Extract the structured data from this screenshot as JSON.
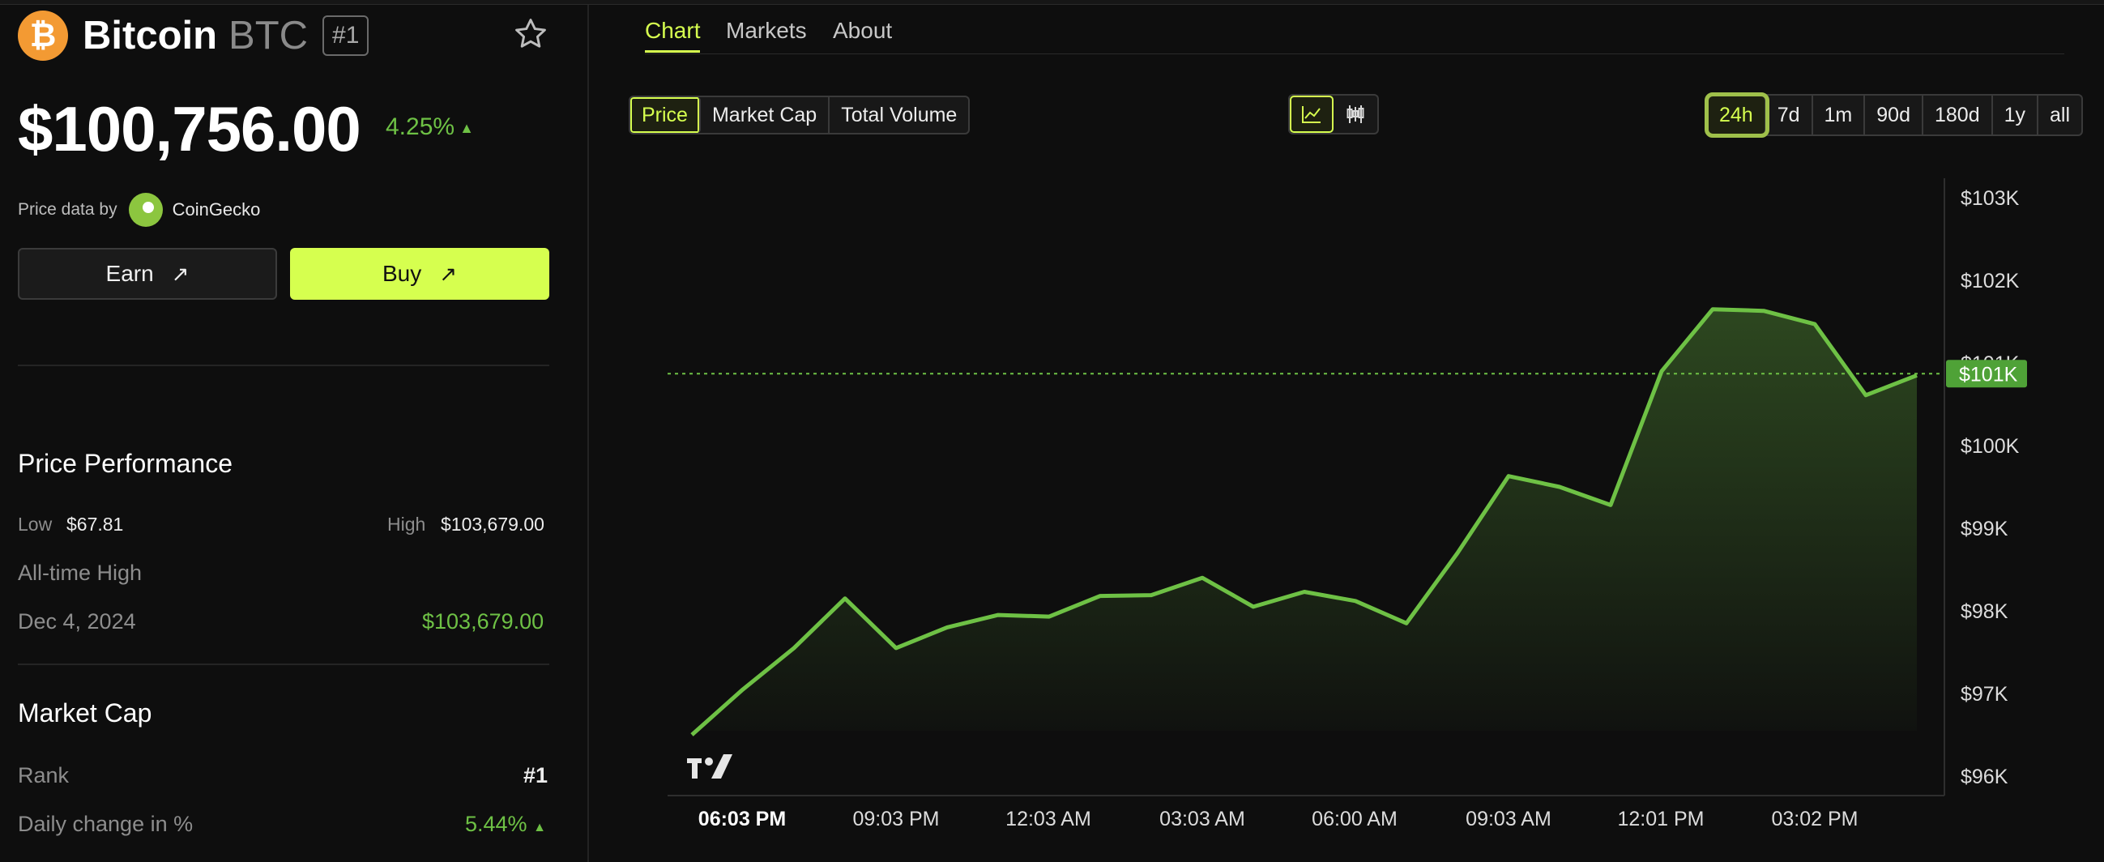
{
  "coin": {
    "name": "Bitcoin",
    "symbol": "BTC",
    "rank_badge": "#1",
    "logo_glyph": "₿",
    "price": "$100,756.00",
    "change": "4.25%",
    "change_arrow": "▲"
  },
  "price_data": {
    "label": "Price data by",
    "provider": "CoinGecko"
  },
  "buttons": {
    "earn": "Earn",
    "buy": "Buy",
    "arrow": "↗"
  },
  "performance": {
    "title": "Price Performance",
    "low_label": "Low",
    "low_value": "$67.81",
    "high_label": "High",
    "high_value": "$103,679.00",
    "ath_label": "All-time High",
    "ath_date": "Dec 4, 2024",
    "ath_value": "$103,679.00"
  },
  "market_cap": {
    "title": "Market Cap",
    "rank_label": "Rank",
    "rank_value": "#1",
    "daily_label": "Daily change in %",
    "daily_value": "5.44%",
    "daily_arrow": "▲"
  },
  "tabs": [
    "Chart",
    "Markets",
    "About"
  ],
  "active_tab": "Chart",
  "metric_options": [
    "Price",
    "Market Cap",
    "Total Volume"
  ],
  "active_metric": "Price",
  "chart_style_icons": [
    "line-chart-icon",
    "candlestick-icon"
  ],
  "ranges": [
    "24h",
    "7d",
    "1m",
    "90d",
    "180d",
    "1y",
    "all"
  ],
  "active_range": "24h",
  "colors": {
    "accent": "#d6ff4f",
    "line": "#6ec145",
    "background": "#0e0e0e"
  },
  "watermark": "TV",
  "chart_data": {
    "type": "area",
    "x": [
      "06:03 PM",
      "09:03 PM",
      "12:03 AM",
      "03:03 AM",
      "06:00 AM",
      "09:03 AM",
      "12:01 PM",
      "03:02 PM"
    ],
    "y_ticks": [
      "$96K",
      "$97K",
      "$98K",
      "$99K",
      "$100K",
      "$101K",
      "$102K",
      "$103K"
    ],
    "ylim": [
      96000,
      103000
    ],
    "current_label": "$101K",
    "current_value": 100850,
    "series": [
      {
        "values": [
          96500,
          97050,
          97550,
          98150,
          97550,
          97800,
          97950,
          97930,
          98180,
          98190,
          98400,
          98050,
          98230,
          98120,
          97850,
          98700,
          99630,
          99500,
          99280,
          100900,
          101650,
          101630,
          101470,
          100610,
          100850
        ]
      }
    ],
    "grid": false
  }
}
